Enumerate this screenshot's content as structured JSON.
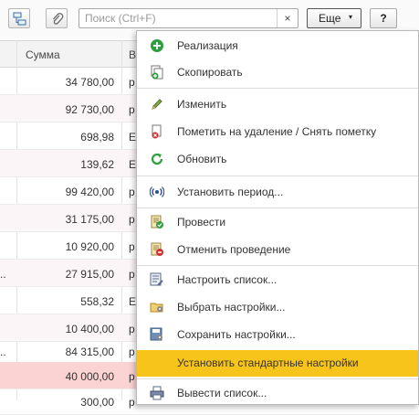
{
  "toolbar": {
    "search_placeholder": "Поиск (Ctrl+F)",
    "clear_label": "×",
    "more_label": "Еще",
    "more_arrow": "▾",
    "help_label": "?"
  },
  "table": {
    "columns": [
      "Сумма",
      "В"
    ],
    "rows": [
      {
        "prefix": "",
        "amount": "34 780,00",
        "currency": "р"
      },
      {
        "prefix": "",
        "amount": "92 730,00",
        "currency": "р"
      },
      {
        "prefix": "",
        "amount": "698,98",
        "currency": "Е"
      },
      {
        "prefix": "",
        "amount": "139,62",
        "currency": "Е"
      },
      {
        "prefix": "",
        "amount": "99 420,00",
        "currency": "р"
      },
      {
        "prefix": "",
        "amount": "31 175,00",
        "currency": "р"
      },
      {
        "prefix": "",
        "amount": "10 920,00",
        "currency": "р"
      },
      {
        "prefix": "..",
        "amount": "27 915,00",
        "currency": "р"
      },
      {
        "prefix": "",
        "amount": "558,32",
        "currency": "Е"
      },
      {
        "prefix": "",
        "amount": "10 400,00",
        "currency": "р"
      },
      {
        "prefix": "..",
        "amount": "84 315,00",
        "currency": "р"
      },
      {
        "prefix": "",
        "amount": "40 000,00",
        "currency": "р"
      },
      {
        "prefix": "",
        "amount": "300,00",
        "currency": "р"
      }
    ]
  },
  "menu": {
    "items": [
      {
        "label": "Реализация",
        "icon": "plus-circle-icon"
      },
      {
        "label": "Скопировать",
        "icon": "copy-icon"
      },
      {
        "label": "Изменить",
        "icon": "pencil-icon"
      },
      {
        "label": "Пометить на удаление / Снять пометку",
        "icon": "delete-mark-icon"
      },
      {
        "label": "Обновить",
        "icon": "refresh-icon"
      },
      {
        "label": "Установить период...",
        "icon": "period-icon"
      },
      {
        "label": "Провести",
        "icon": "post-document-icon"
      },
      {
        "label": "Отменить проведение",
        "icon": "unpost-document-icon"
      },
      {
        "label": "Настроить список...",
        "icon": "list-settings-icon"
      },
      {
        "label": "Выбрать настройки...",
        "icon": "load-settings-icon"
      },
      {
        "label": "Сохранить настройки...",
        "icon": "save-settings-icon"
      },
      {
        "label": "Установить стандартные настройки",
        "icon": "none"
      },
      {
        "label": "Вывести список...",
        "icon": "print-list-icon"
      }
    ]
  },
  "colors": {
    "highlight": "#f7c41c",
    "selected_row": "#fbd3d3",
    "green_icon": "#2e9e3e"
  }
}
